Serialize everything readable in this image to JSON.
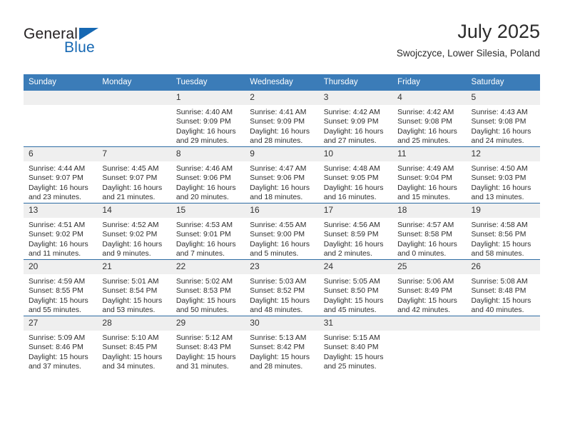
{
  "brand": {
    "name_part1": "General",
    "name_part2": "Blue",
    "accent_color": "#1668b3"
  },
  "header": {
    "title": "July 2025",
    "subtitle": "Swojczyce, Lower Silesia, Poland"
  },
  "theme": {
    "header_blue": "#3b7cb8",
    "row_border_blue": "#2e6da4",
    "daynum_band": "#efefef"
  },
  "weekday_headers": [
    "Sunday",
    "Monday",
    "Tuesday",
    "Wednesday",
    "Thursday",
    "Friday",
    "Saturday"
  ],
  "weeks": [
    [
      {
        "day": "",
        "sunrise": "",
        "sunset": "",
        "daylight": ""
      },
      {
        "day": "",
        "sunrise": "",
        "sunset": "",
        "daylight": ""
      },
      {
        "day": "1",
        "sunrise": "Sunrise: 4:40 AM",
        "sunset": "Sunset: 9:09 PM",
        "daylight": "Daylight: 16 hours and 29 minutes."
      },
      {
        "day": "2",
        "sunrise": "Sunrise: 4:41 AM",
        "sunset": "Sunset: 9:09 PM",
        "daylight": "Daylight: 16 hours and 28 minutes."
      },
      {
        "day": "3",
        "sunrise": "Sunrise: 4:42 AM",
        "sunset": "Sunset: 9:09 PM",
        "daylight": "Daylight: 16 hours and 27 minutes."
      },
      {
        "day": "4",
        "sunrise": "Sunrise: 4:42 AM",
        "sunset": "Sunset: 9:08 PM",
        "daylight": "Daylight: 16 hours and 25 minutes."
      },
      {
        "day": "5",
        "sunrise": "Sunrise: 4:43 AM",
        "sunset": "Sunset: 9:08 PM",
        "daylight": "Daylight: 16 hours and 24 minutes."
      }
    ],
    [
      {
        "day": "6",
        "sunrise": "Sunrise: 4:44 AM",
        "sunset": "Sunset: 9:07 PM",
        "daylight": "Daylight: 16 hours and 23 minutes."
      },
      {
        "day": "7",
        "sunrise": "Sunrise: 4:45 AM",
        "sunset": "Sunset: 9:07 PM",
        "daylight": "Daylight: 16 hours and 21 minutes."
      },
      {
        "day": "8",
        "sunrise": "Sunrise: 4:46 AM",
        "sunset": "Sunset: 9:06 PM",
        "daylight": "Daylight: 16 hours and 20 minutes."
      },
      {
        "day": "9",
        "sunrise": "Sunrise: 4:47 AM",
        "sunset": "Sunset: 9:06 PM",
        "daylight": "Daylight: 16 hours and 18 minutes."
      },
      {
        "day": "10",
        "sunrise": "Sunrise: 4:48 AM",
        "sunset": "Sunset: 9:05 PM",
        "daylight": "Daylight: 16 hours and 16 minutes."
      },
      {
        "day": "11",
        "sunrise": "Sunrise: 4:49 AM",
        "sunset": "Sunset: 9:04 PM",
        "daylight": "Daylight: 16 hours and 15 minutes."
      },
      {
        "day": "12",
        "sunrise": "Sunrise: 4:50 AM",
        "sunset": "Sunset: 9:03 PM",
        "daylight": "Daylight: 16 hours and 13 minutes."
      }
    ],
    [
      {
        "day": "13",
        "sunrise": "Sunrise: 4:51 AM",
        "sunset": "Sunset: 9:02 PM",
        "daylight": "Daylight: 16 hours and 11 minutes."
      },
      {
        "day": "14",
        "sunrise": "Sunrise: 4:52 AM",
        "sunset": "Sunset: 9:02 PM",
        "daylight": "Daylight: 16 hours and 9 minutes."
      },
      {
        "day": "15",
        "sunrise": "Sunrise: 4:53 AM",
        "sunset": "Sunset: 9:01 PM",
        "daylight": "Daylight: 16 hours and 7 minutes."
      },
      {
        "day": "16",
        "sunrise": "Sunrise: 4:55 AM",
        "sunset": "Sunset: 9:00 PM",
        "daylight": "Daylight: 16 hours and 5 minutes."
      },
      {
        "day": "17",
        "sunrise": "Sunrise: 4:56 AM",
        "sunset": "Sunset: 8:59 PM",
        "daylight": "Daylight: 16 hours and 2 minutes."
      },
      {
        "day": "18",
        "sunrise": "Sunrise: 4:57 AM",
        "sunset": "Sunset: 8:58 PM",
        "daylight": "Daylight: 16 hours and 0 minutes."
      },
      {
        "day": "19",
        "sunrise": "Sunrise: 4:58 AM",
        "sunset": "Sunset: 8:56 PM",
        "daylight": "Daylight: 15 hours and 58 minutes."
      }
    ],
    [
      {
        "day": "20",
        "sunrise": "Sunrise: 4:59 AM",
        "sunset": "Sunset: 8:55 PM",
        "daylight": "Daylight: 15 hours and 55 minutes."
      },
      {
        "day": "21",
        "sunrise": "Sunrise: 5:01 AM",
        "sunset": "Sunset: 8:54 PM",
        "daylight": "Daylight: 15 hours and 53 minutes."
      },
      {
        "day": "22",
        "sunrise": "Sunrise: 5:02 AM",
        "sunset": "Sunset: 8:53 PM",
        "daylight": "Daylight: 15 hours and 50 minutes."
      },
      {
        "day": "23",
        "sunrise": "Sunrise: 5:03 AM",
        "sunset": "Sunset: 8:52 PM",
        "daylight": "Daylight: 15 hours and 48 minutes."
      },
      {
        "day": "24",
        "sunrise": "Sunrise: 5:05 AM",
        "sunset": "Sunset: 8:50 PM",
        "daylight": "Daylight: 15 hours and 45 minutes."
      },
      {
        "day": "25",
        "sunrise": "Sunrise: 5:06 AM",
        "sunset": "Sunset: 8:49 PM",
        "daylight": "Daylight: 15 hours and 42 minutes."
      },
      {
        "day": "26",
        "sunrise": "Sunrise: 5:08 AM",
        "sunset": "Sunset: 8:48 PM",
        "daylight": "Daylight: 15 hours and 40 minutes."
      }
    ],
    [
      {
        "day": "27",
        "sunrise": "Sunrise: 5:09 AM",
        "sunset": "Sunset: 8:46 PM",
        "daylight": "Daylight: 15 hours and 37 minutes."
      },
      {
        "day": "28",
        "sunrise": "Sunrise: 5:10 AM",
        "sunset": "Sunset: 8:45 PM",
        "daylight": "Daylight: 15 hours and 34 minutes."
      },
      {
        "day": "29",
        "sunrise": "Sunrise: 5:12 AM",
        "sunset": "Sunset: 8:43 PM",
        "daylight": "Daylight: 15 hours and 31 minutes."
      },
      {
        "day": "30",
        "sunrise": "Sunrise: 5:13 AM",
        "sunset": "Sunset: 8:42 PM",
        "daylight": "Daylight: 15 hours and 28 minutes."
      },
      {
        "day": "31",
        "sunrise": "Sunrise: 5:15 AM",
        "sunset": "Sunset: 8:40 PM",
        "daylight": "Daylight: 15 hours and 25 minutes."
      },
      {
        "day": "",
        "sunrise": "",
        "sunset": "",
        "daylight": ""
      },
      {
        "day": "",
        "sunrise": "",
        "sunset": "",
        "daylight": ""
      }
    ]
  ]
}
